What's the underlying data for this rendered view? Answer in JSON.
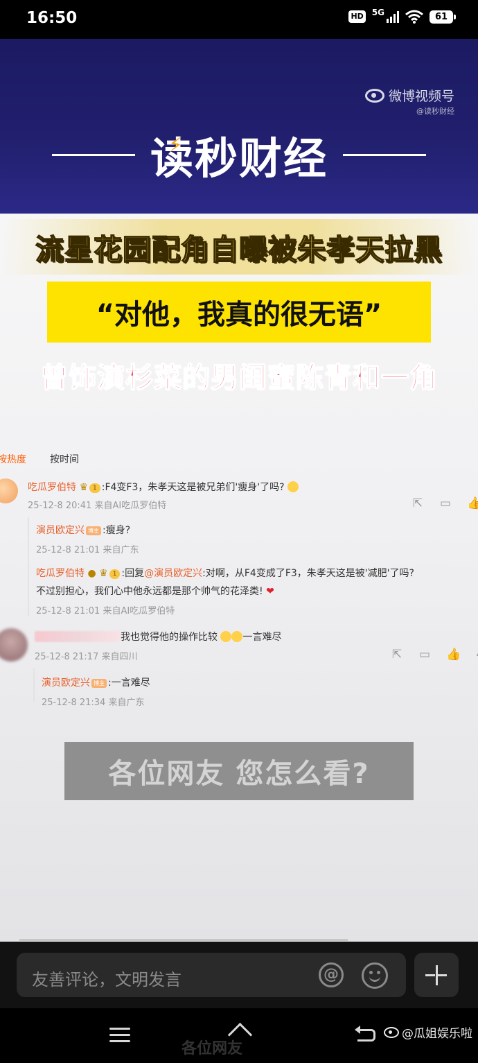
{
  "status_bar": {
    "time": "16:50",
    "hd": "HD",
    "network": "5G",
    "battery": "61"
  },
  "video": {
    "weibo_mark": "微博视频号",
    "weibo_handle": "@读秒财经",
    "brand_title": "读秒财经",
    "headline_1": "流星花园配角自曝被朱孝天拉黑",
    "headline_2": "“对他，我真的很无语”",
    "headline_3": "曾饰演杉菜的男闺蜜陈青和一角",
    "question": "各位网友 您怎么看?",
    "progress_fraction": 0.72
  },
  "comments": {
    "sort_hot": "按热度",
    "sort_time": "按时间",
    "items": [
      {
        "user": "吃瓜罗伯特",
        "vip_level": "1",
        "text": ":F4变F3，朱孝天这是被兄弟们'瘦身'了吗?",
        "meta": "25-12-8 20:41 来自AI吃瓜罗伯特"
      },
      {
        "user": "演员欧定兴",
        "tag": "博主",
        "text": ":瘦身?",
        "meta": "25-12-8 21:01 来自广东"
      },
      {
        "user": "吃瓜罗伯特",
        "vip_level": "1",
        "reply_prefix": ":回复",
        "reply_at": "@演员欧定兴",
        "text": ":对啊，从F4变成了F3，朱孝天这是被'减肥'了吗?",
        "text_2": "不过别担心，我们心中他永远都是那个帅气的花泽类!",
        "meta": "25-12-8 21:01 来自AI吃瓜罗伯特"
      },
      {
        "text": "我也觉得他的操作比较",
        "text_tail": "一言难尽",
        "meta": "25-12-8 21:17 来自四川"
      },
      {
        "user": "演员欧定兴",
        "tag": "博主",
        "text": ":一言难尽",
        "meta": "25-12-8 21:34 来自广东"
      }
    ],
    "action_icons": [
      "share-icon",
      "comment-icon",
      "like-icon"
    ],
    "like_count_partial": "4"
  },
  "composer": {
    "placeholder": "友善评论，文明发言",
    "at_symbol": "@"
  },
  "watermark": "@瓜姐娱乐啦",
  "ghost_caption": "各位网友",
  "colors": {
    "banner": "#22206f",
    "headline_yellow": "#ffe14b",
    "quote_box": "#ffe300",
    "headline_red": "#e8183c",
    "username": "#e8612c"
  }
}
